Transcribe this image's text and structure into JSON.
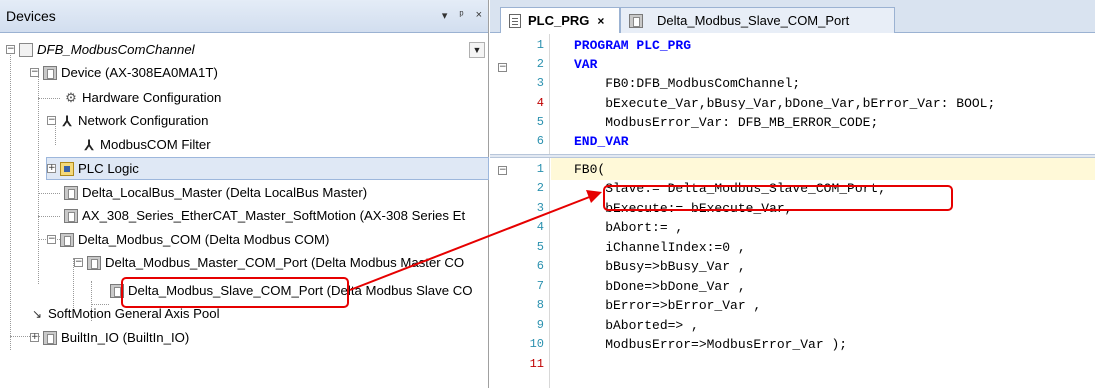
{
  "devices_panel": {
    "title": "Devices",
    "header_buttons": [
      "▾",
      "ᵖ",
      "×"
    ]
  },
  "tree": [
    {
      "label": "DFB_ModbusComChannel",
      "italic": true
    },
    {
      "label": "Device (AX-308EA0MA1T)"
    },
    {
      "label": "Hardware Configuration"
    },
    {
      "label": "Network Configuration"
    },
    {
      "label": "ModbusCOM Filter"
    },
    {
      "label": "PLC Logic"
    },
    {
      "label": "Delta_LocalBus_Master (Delta LocalBus Master)"
    },
    {
      "label": "AX_308_Series_EtherCAT_Master_SoftMotion (AX-308 Series Et"
    },
    {
      "label": "Delta_Modbus_COM (Delta Modbus COM)"
    },
    {
      "label": "Delta_Modbus_Master_COM_Port (Delta Modbus Master CO"
    },
    {
      "label": "Delta_Modbus_Slave_COM_Port (Delta Modbus Slave CO"
    },
    {
      "label": "SoftMotion General Axis Pool"
    },
    {
      "label": "BuiltIn_IO (BuiltIn_IO)"
    }
  ],
  "tabs": [
    {
      "label": "PLC_PRG",
      "close": "×"
    },
    {
      "label": "Delta_Modbus_Slave_COM_Port"
    }
  ],
  "declaration": {
    "line_numbers": [
      "1",
      "2",
      "3",
      "4",
      "5",
      "6"
    ],
    "lines": [
      "PROGRAM PLC_PRG",
      "VAR",
      "    FB0:DFB_ModbusComChannel;",
      "    bExecute_Var,bBusy_Var,bDone_Var,bError_Var: BOOL;",
      "    ModbusError_Var: DFB_MB_ERROR_CODE;",
      "END_VAR"
    ]
  },
  "body": {
    "line_numbers": [
      "1",
      "2",
      "3",
      "4",
      "5",
      "6",
      "7",
      "8",
      "9",
      "10",
      "11"
    ],
    "lines": [
      "FB0(",
      "    Slave:= Delta_Modbus_Slave_COM_Port,",
      "    bExecute:= bExecute_Var,",
      "    bAbort:= ,",
      "    iChannelIndex:=0 ,",
      "    bBusy=>bBusy_Var ,",
      "    bDone=>bDone_Var ,",
      "    bError=>bError_Var ,",
      "    bAborted=> ,",
      "    ModbusError=>ModbusError_Var );",
      ""
    ]
  },
  "colors": {
    "highlight": "#e60000",
    "keyword": "#0000ff",
    "line_number": "#2b91af",
    "error_line_number": "#c00000"
  }
}
